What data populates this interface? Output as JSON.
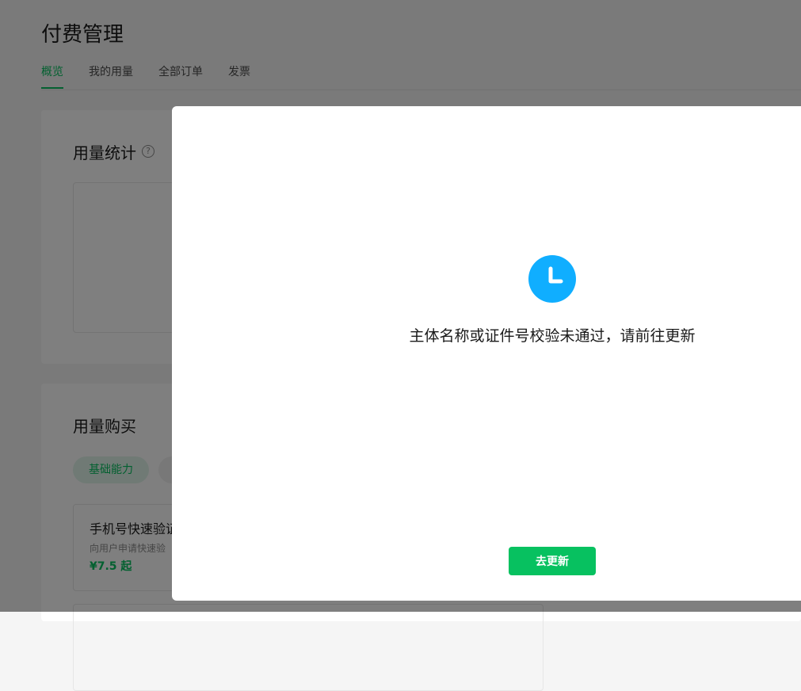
{
  "page": {
    "title": "付费管理",
    "tabs": [
      {
        "label": "概览",
        "active": true
      },
      {
        "label": "我的用量",
        "active": false
      },
      {
        "label": "全部订单",
        "active": false
      },
      {
        "label": "发票",
        "active": false
      }
    ]
  },
  "stats": {
    "title": "用量统计",
    "help_glyph": "?"
  },
  "purchase": {
    "title": "用量购买",
    "category_active": "基础能力",
    "product": {
      "name": "手机号快速验证",
      "description": "向用户申请快速验",
      "price": "¥7.5 起"
    }
  },
  "dialog": {
    "icon": "clock-icon",
    "message": "主体名称或证件号校验未通过，请前往更新",
    "button_label": "去更新"
  },
  "colors": {
    "accent": "#07c160",
    "info_icon": "#10aeff",
    "overlay": "rgba(0,0,0,0.5)"
  }
}
